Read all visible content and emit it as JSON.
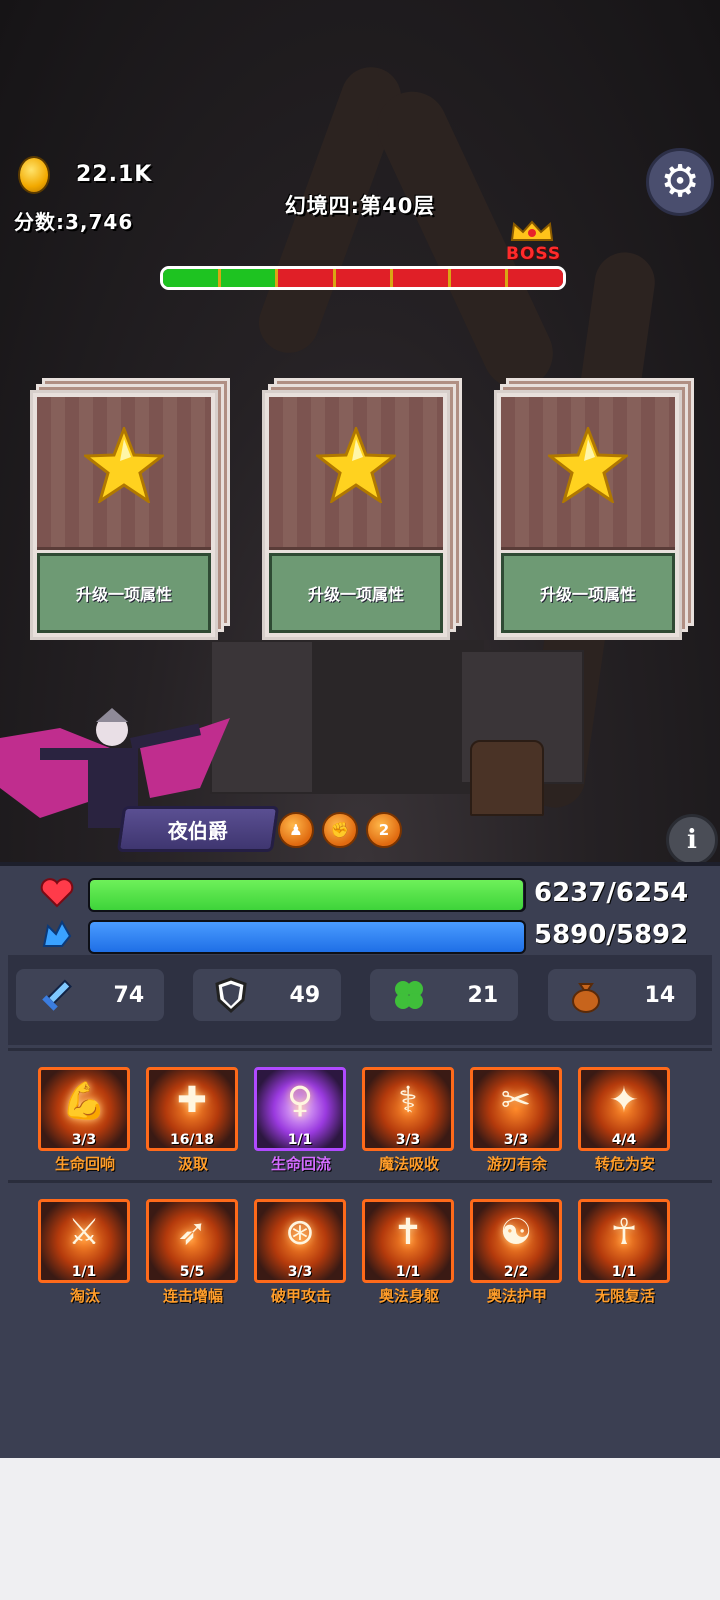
{
  "hud": {
    "coins": "22.1K",
    "score_label": "分数:",
    "score": "3,746",
    "stage_title": "幻境四:第40层",
    "boss_label": "BOSS"
  },
  "progress": {
    "segments": 7,
    "completed": 2,
    "colors": {
      "done": "#1ec321",
      "todo": "#e01f27"
    }
  },
  "cards": [
    {
      "label": "升级一项属性",
      "icon": "star-icon"
    },
    {
      "label": "升级一项属性",
      "icon": "star-icon"
    },
    {
      "label": "升级一项属性",
      "icon": "star-icon"
    }
  ],
  "character": {
    "name": "夜伯爵",
    "buff_badge": "2"
  },
  "stats": {
    "hp": {
      "value": "6237/6254",
      "current": 6237,
      "max": 6254,
      "color": "#3ed43a"
    },
    "mp": {
      "value": "5890/5892",
      "current": 5890,
      "max": 5892,
      "color": "#1f6fe6"
    },
    "attack": "74",
    "defense": "49",
    "luck": "21",
    "loot": "14"
  },
  "skills_row1": [
    {
      "name": "生命回响",
      "level": "3/3",
      "icon": "arm-icon"
    },
    {
      "name": "汲取",
      "level": "16/18",
      "icon": "medic-icon"
    },
    {
      "name": "生命回流",
      "level": "1/1",
      "icon": "angel-icon",
      "highlight": true
    },
    {
      "name": "魔法吸收",
      "level": "3/3",
      "icon": "caduceus-icon"
    },
    {
      "name": "游刃有余",
      "level": "3/3",
      "icon": "blade-icon"
    },
    {
      "name": "转危为安",
      "level": "4/4",
      "icon": "sparkle-icon"
    }
  ],
  "skills_row2": [
    {
      "name": "淘汰",
      "level": "1/1",
      "icon": "sword-icon"
    },
    {
      "name": "连击增幅",
      "level": "5/5",
      "icon": "runner-icon"
    },
    {
      "name": "破甲攻击",
      "level": "3/3",
      "icon": "orbit-icon"
    },
    {
      "name": "奥法身躯",
      "level": "1/1",
      "icon": "winged-cross-icon"
    },
    {
      "name": "奥法护甲",
      "level": "2/2",
      "icon": "meditate-icon"
    },
    {
      "name": "无限复活",
      "level": "1/1",
      "icon": "ankh-icon"
    }
  ]
}
